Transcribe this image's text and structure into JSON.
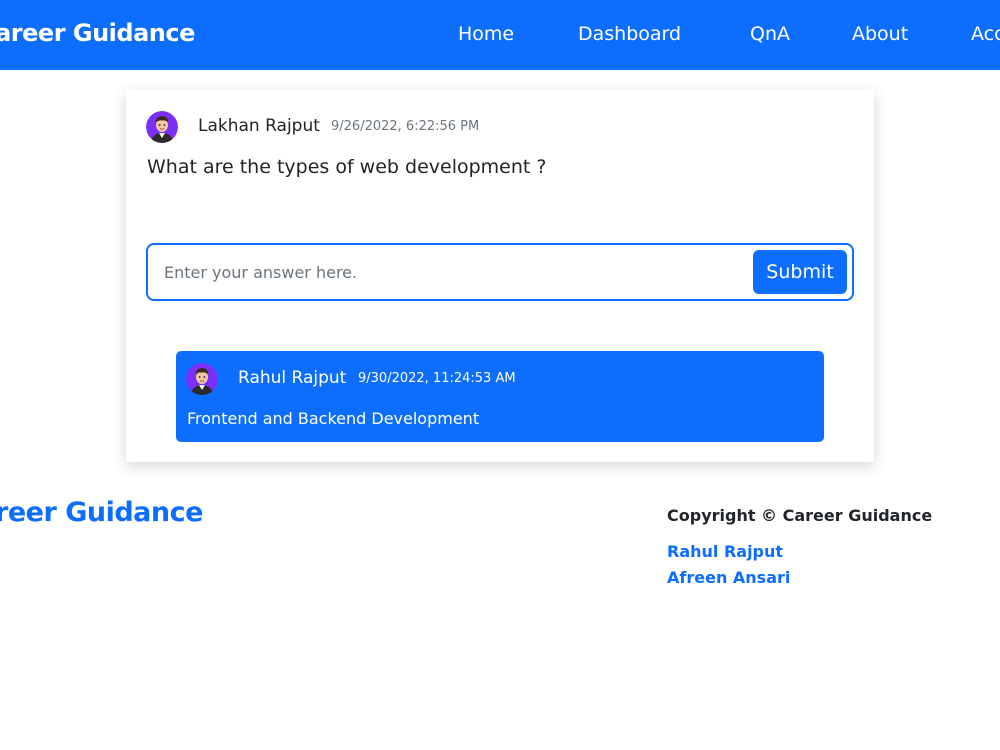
{
  "navbar": {
    "brand": "Career Guidance",
    "links": [
      "Home",
      "Dashboard",
      "QnA",
      "About",
      "Account"
    ]
  },
  "question": {
    "author": "Lakhan Rajput",
    "timestamp": "9/26/2022, 6:22:56 PM",
    "text": "What are the types of web development ?",
    "avatar_icon": "user-avatar-icon"
  },
  "answer_form": {
    "placeholder": "Enter your answer here.",
    "value": "",
    "submit_label": "Submit"
  },
  "answers": [
    {
      "author": "Rahul Rajput",
      "timestamp": "9/30/2022, 11:24:53 AM",
      "text": "Frontend and Backend Development",
      "avatar_icon": "user-avatar-icon"
    }
  ],
  "footer": {
    "brand": "Career Guidance",
    "copyright": "Copyright © Career Guidance",
    "developers": [
      "Rahul Rajput",
      "Afreen Ansari"
    ]
  },
  "colors": {
    "primary": "#0d6efd",
    "text": "#212529",
    "muted": "#6c757d",
    "avatar_bg": "#7b2ff7"
  }
}
